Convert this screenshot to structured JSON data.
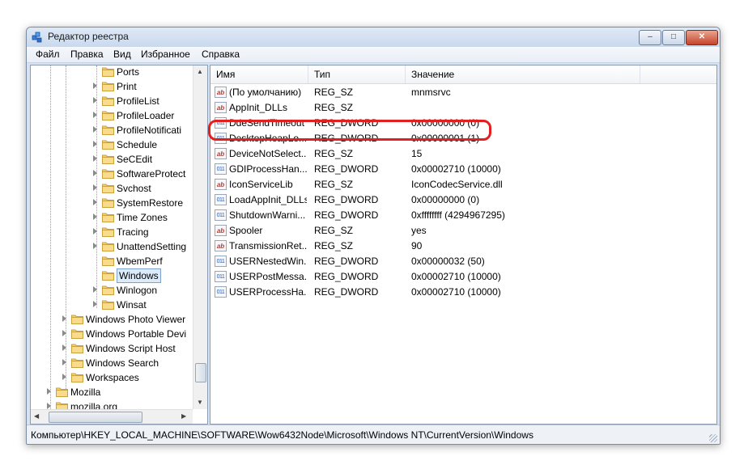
{
  "window": {
    "title": "Редактор реестра",
    "buttons": {
      "minimize": "–",
      "maximize": "□",
      "close": "✕"
    }
  },
  "menu": [
    "Файл",
    "Правка",
    "Вид",
    "Избранное",
    "Справка"
  ],
  "tree": {
    "items": [
      {
        "label": "Ports",
        "expander": false
      },
      {
        "label": "Print",
        "expander": true
      },
      {
        "label": "ProfileList",
        "expander": true
      },
      {
        "label": "ProfileLoader",
        "expander": true
      },
      {
        "label": "ProfileNotificati",
        "expander": true
      },
      {
        "label": "Schedule",
        "expander": true
      },
      {
        "label": "SeCEdit",
        "expander": true
      },
      {
        "label": "SoftwareProtect",
        "expander": true
      },
      {
        "label": "Svchost",
        "expander": true
      },
      {
        "label": "SystemRestore",
        "expander": true
      },
      {
        "label": "Time Zones",
        "expander": true
      },
      {
        "label": "Tracing",
        "expander": true
      },
      {
        "label": "UnattendSetting",
        "expander": true
      },
      {
        "label": "WbemPerf",
        "expander": false
      },
      {
        "label": "Windows",
        "expander": false,
        "selected": true
      },
      {
        "label": "Winlogon",
        "expander": true
      },
      {
        "label": "Winsat",
        "expander": true
      }
    ],
    "parent_items": [
      {
        "label": "Windows Photo Viewer",
        "expander": true
      },
      {
        "label": "Windows Portable Devi",
        "expander": true
      },
      {
        "label": "Windows Script Host",
        "expander": true
      },
      {
        "label": "Windows Search",
        "expander": true
      },
      {
        "label": "Workspaces",
        "expander": true
      }
    ],
    "root_items": [
      {
        "label": "Mozilla",
        "expander": true
      },
      {
        "label": "mozilla.org",
        "expander": true
      }
    ]
  },
  "list": {
    "columns": {
      "name": "Имя",
      "type": "Тип",
      "data": "Значение"
    },
    "rows": [
      {
        "icon": "ab",
        "kind": "sz",
        "name": "(По умолчанию)",
        "type": "REG_SZ",
        "data": "mnmsrvc"
      },
      {
        "icon": "ab",
        "kind": "sz",
        "name": "AppInit_DLLs",
        "type": "REG_SZ",
        "data": ""
      },
      {
        "icon": "011",
        "kind": "bin",
        "name": "DdeSendTimeout",
        "type": "REG_DWORD",
        "data": "0x00000000 (0)"
      },
      {
        "icon": "011",
        "kind": "bin",
        "name": "DesktopHeapLo...",
        "type": "REG_DWORD",
        "data": "0x00000001 (1)"
      },
      {
        "icon": "ab",
        "kind": "sz",
        "name": "DeviceNotSelect...",
        "type": "REG_SZ",
        "data": "15"
      },
      {
        "icon": "011",
        "kind": "bin",
        "name": "GDIProcessHan...",
        "type": "REG_DWORD",
        "data": "0x00002710 (10000)"
      },
      {
        "icon": "ab",
        "kind": "sz",
        "name": "IconServiceLib",
        "type": "REG_SZ",
        "data": "IconCodecService.dll"
      },
      {
        "icon": "011",
        "kind": "bin",
        "name": "LoadAppInit_DLLs",
        "type": "REG_DWORD",
        "data": "0x00000000 (0)"
      },
      {
        "icon": "011",
        "kind": "bin",
        "name": "ShutdownWarni...",
        "type": "REG_DWORD",
        "data": "0xffffffff (4294967295)"
      },
      {
        "icon": "ab",
        "kind": "sz",
        "name": "Spooler",
        "type": "REG_SZ",
        "data": "yes"
      },
      {
        "icon": "ab",
        "kind": "sz",
        "name": "TransmissionRet...",
        "type": "REG_SZ",
        "data": "90"
      },
      {
        "icon": "011",
        "kind": "bin",
        "name": "USERNestedWin...",
        "type": "REG_DWORD",
        "data": "0x00000032 (50)"
      },
      {
        "icon": "011",
        "kind": "bin",
        "name": "USERPostMessa...",
        "type": "REG_DWORD",
        "data": "0x00002710 (10000)"
      },
      {
        "icon": "011",
        "kind": "bin",
        "name": "USERProcessHa...",
        "type": "REG_DWORD",
        "data": "0x00002710 (10000)"
      }
    ]
  },
  "status": {
    "path": "Компьютер\\HKEY_LOCAL_MACHINE\\SOFTWARE\\Wow6432Node\\Microsoft\\Windows NT\\CurrentVersion\\Windows"
  },
  "colors": {
    "highlight": "#e41f1f",
    "folder": "#f4d27a",
    "selection": "#dcebfc"
  }
}
